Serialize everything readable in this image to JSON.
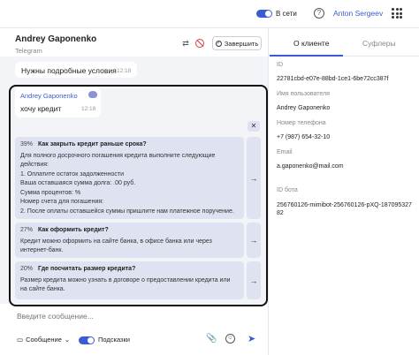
{
  "topbar": {
    "online_label": "В сети",
    "help_glyph": "?",
    "user_name": "Anton Sergeev"
  },
  "chat": {
    "contact_name": "Andrey Gaponenko",
    "channel": "Telegram",
    "finish_label": "Завершить",
    "messages": [
      {
        "text": "Нужны подробные условия",
        "time": "12:18"
      }
    ],
    "operator_message": {
      "name": "Andrey Gaponenko",
      "text": "хочу кредит",
      "time": "12:18"
    }
  },
  "suggestions": [
    {
      "percent": "39%",
      "title": "Как закрыть кредит раньше срока?",
      "lines": [
        "Для полного досрочного погашения кредита выполните следующие действия:",
        "1. Оплатите остаток задолженности",
        "Ваша оставшаяся сумма долга: .00 руб.",
        "Сумма процентов: %",
        "Номер счета для погашения: ",
        "2. После оплаты оставшейся суммы пришлите нам платежное поручение."
      ]
    },
    {
      "percent": "27%",
      "title": "Как оформить кредит?",
      "lines": [
        "Кредит можно оформить на сайте банка, в офисе банка или через интернет-банк."
      ]
    },
    {
      "percent": "20%",
      "title": "Где посчитать размер кредита?",
      "lines": [
        "Размер кредита можно узнать в договоре о предоставлении кредита или на сайте банка."
      ]
    }
  ],
  "composer": {
    "placeholder": "Введите сообщение...",
    "mode_label": "Сообщение",
    "hints_label": "Подсказки"
  },
  "client_panel": {
    "tabs": [
      "О клиенте",
      "Суфлеры"
    ],
    "active_tab": "О клиенте",
    "fields": [
      {
        "label": "ID",
        "value": "22781cbd-e07e-88bd-1ce1-6be72cc387f"
      },
      {
        "label": "Имя пользователя",
        "value": "Andrey Gaponenko"
      },
      {
        "label": "Номер телефона",
        "value": "+7 (987) 654-32-10"
      },
      {
        "label": "Email",
        "value": "a.gaponenko@mail.com"
      },
      {
        "label": "ID бота",
        "value": "256760126-mimibot-256760126-pXQ-18709532782"
      }
    ]
  },
  "colors": {
    "accent": "#3b5bd6",
    "suggestion_bg": "#dfe3f1",
    "chat_bg": "#f3f4f8",
    "danger": "#d94040"
  }
}
